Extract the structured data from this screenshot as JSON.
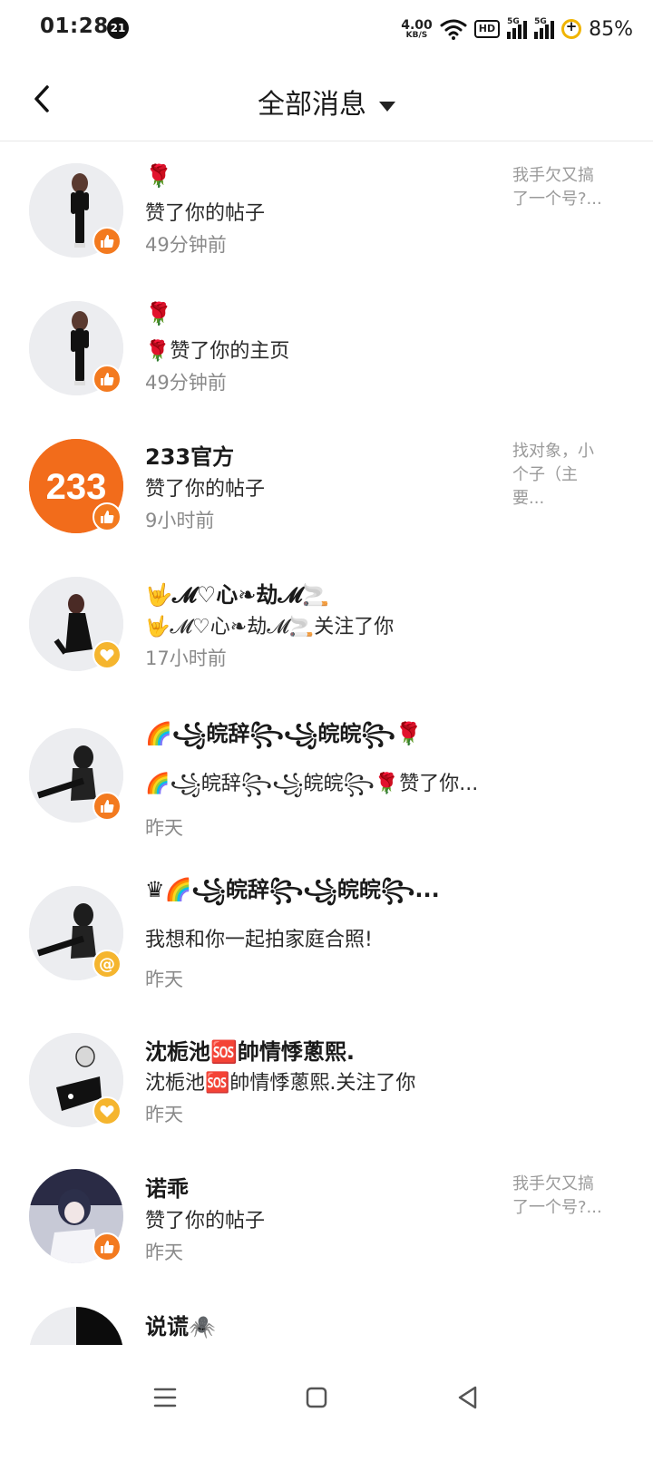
{
  "status_bar": {
    "time": "01:28",
    "notification_count": "21",
    "net_speed": "4.00",
    "net_unit": "KB/S",
    "hd_label": "HD",
    "sim1": "5G",
    "sim2": "5G",
    "battery": "85%"
  },
  "header": {
    "title": "全部消息",
    "back_icon": "chevron-left-icon",
    "dropdown_icon": "caret-down-icon"
  },
  "messages": [
    {
      "name": "🌹",
      "action": "赞了你的帖子",
      "time": "49分钟前",
      "side": "我手欠又搞了一个号?...",
      "badge": "like"
    },
    {
      "name": "🌹",
      "action": "🌹赞了你的主页",
      "time": "49分钟前",
      "side": "",
      "badge": "like"
    },
    {
      "name": "233官方",
      "action": "赞了你的帖子",
      "time": "9小时前",
      "side": "找对象，小个子（主要...",
      "badge": "like",
      "avatar_text": "233"
    },
    {
      "name": "🤟𝓜♡心❧劫𝓜🚬",
      "action": "🤟𝓜♡心❧劫𝓜🚬关注了你",
      "time": "17小时前",
      "side": "",
      "badge": "follow"
    },
    {
      "name": "🌈꧁皖辞꧂꧁皖皖꧂🌹",
      "action": "🌈꧁皖辞꧂꧁皖皖꧂🌹赞了你...",
      "time": "昨天",
      "side": "",
      "badge": "like"
    },
    {
      "name": "♛🌈꧁皖辞꧂꧁皖皖꧂...",
      "action": "我想和你一起拍家庭合照!",
      "time": "昨天",
      "side": "",
      "badge": "at",
      "badge_text": "@"
    },
    {
      "name": "沈栀池🆘帥情悸蔥熙.",
      "action": "沈栀池🆘帥情悸蔥熙.关注了你",
      "time": "昨天",
      "side": "",
      "badge": "follow"
    },
    {
      "name": "诺乖",
      "action": "赞了你的帖子",
      "time": "昨天",
      "side": "我手欠又搞了一个号?...",
      "badge": "like"
    },
    {
      "name": "说谎🕷️",
      "action": "",
      "time": "",
      "side": "",
      "badge": ""
    }
  ],
  "colors": {
    "like_badge": "#f37a1f",
    "follow_badge": "#f5b52e",
    "official_avatar": "#f26c1b"
  },
  "nav": {
    "menu_icon": "menu-icon",
    "home_icon": "square-home-icon",
    "back_icon": "triangle-back-icon"
  }
}
